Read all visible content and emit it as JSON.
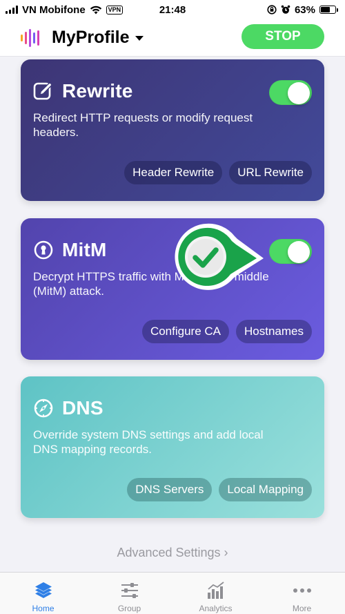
{
  "status_bar": {
    "carrier": "VN Mobifone",
    "vpn": "VPN",
    "time": "21:48",
    "battery": "63%",
    "battery_level": 0.63
  },
  "header": {
    "title": "MyProfile",
    "stop_label": "STOP"
  },
  "colors": {
    "accent_green": "#4cd964",
    "tab_active": "#2f7fe6",
    "tab_inactive": "#8e8e93"
  },
  "cards": [
    {
      "title": "Rewrite",
      "icon": "edit-icon",
      "description": "Redirect HTTP requests or modify request headers.",
      "enabled": true,
      "buttons": [
        "Header Rewrite",
        "URL Rewrite"
      ]
    },
    {
      "title": "MitM",
      "icon": "keyhole-icon",
      "description": "Decrypt HTTPS traffic with Man-in-the-middle (MitM) attack.",
      "enabled": true,
      "buttons": [
        "Configure CA",
        "Hostnames"
      ]
    },
    {
      "title": "DNS",
      "icon": "compass-icon",
      "description": "Override system DNS settings and add local DNS mapping records.",
      "enabled": false,
      "buttons": [
        "DNS Servers",
        "Local Mapping"
      ]
    }
  ],
  "advanced_settings": "Advanced Settings ›",
  "tabs": [
    {
      "label": "Home",
      "icon": "layers-icon",
      "active": true
    },
    {
      "label": "Group",
      "icon": "sliders-icon",
      "active": false
    },
    {
      "label": "Analytics",
      "icon": "chart-icon",
      "active": false
    },
    {
      "label": "More",
      "icon": "more-icon",
      "active": false
    }
  ]
}
